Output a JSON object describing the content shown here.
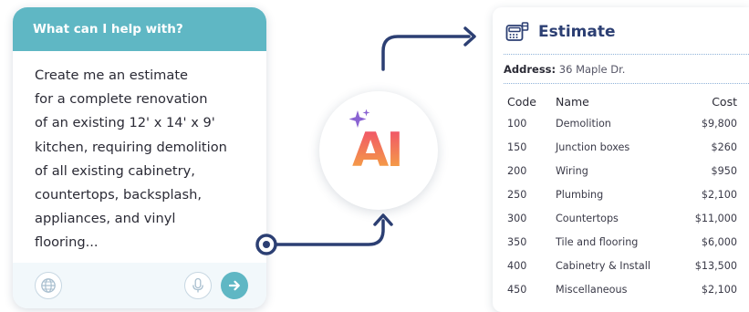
{
  "colors": {
    "teal": "#5fb7c4",
    "navy_arrow": "#2c3f73",
    "title_navy": "#2c3f73",
    "ai_gradient_top": "#f0486e",
    "ai_gradient_bottom": "#f5b03e",
    "sparkle": "#8a63d2"
  },
  "chat": {
    "header": "What can I help with?",
    "lines": [
      "Create me an estimate",
      "for a complete renovation",
      "of an existing 12' x 14' x 9'",
      "kitchen, requiring demolition",
      "of all existing cabinetry,",
      "countertops, backsplash,",
      "appliances, and vinyl",
      "flooring..."
    ],
    "icons": {
      "globe": "globe-icon",
      "mic": "microphone-icon",
      "send": "arrow-right-icon"
    }
  },
  "ai": {
    "label": "AI",
    "icon": "sparkle-icon"
  },
  "estimate": {
    "icon": "register-icon",
    "title": "Estimate",
    "address_label": "Address:",
    "address_value": "36 Maple Dr.",
    "columns": [
      "Code",
      "Name",
      "Cost"
    ],
    "rows": [
      {
        "code": "100",
        "name": "Demolition",
        "cost": "$9,800"
      },
      {
        "code": "150",
        "name": "Junction boxes",
        "cost": "$260"
      },
      {
        "code": "200",
        "name": "Wiring",
        "cost": "$950"
      },
      {
        "code": "250",
        "name": "Plumbing",
        "cost": "$2,100"
      },
      {
        "code": "300",
        "name": "Countertops",
        "cost": "$11,000"
      },
      {
        "code": "350",
        "name": "Tile and flooring",
        "cost": "$6,000"
      },
      {
        "code": "400",
        "name": "Cabinetry & Install",
        "cost": "$13,500"
      },
      {
        "code": "450",
        "name": "Miscellaneous",
        "cost": "$2,100"
      }
    ]
  }
}
